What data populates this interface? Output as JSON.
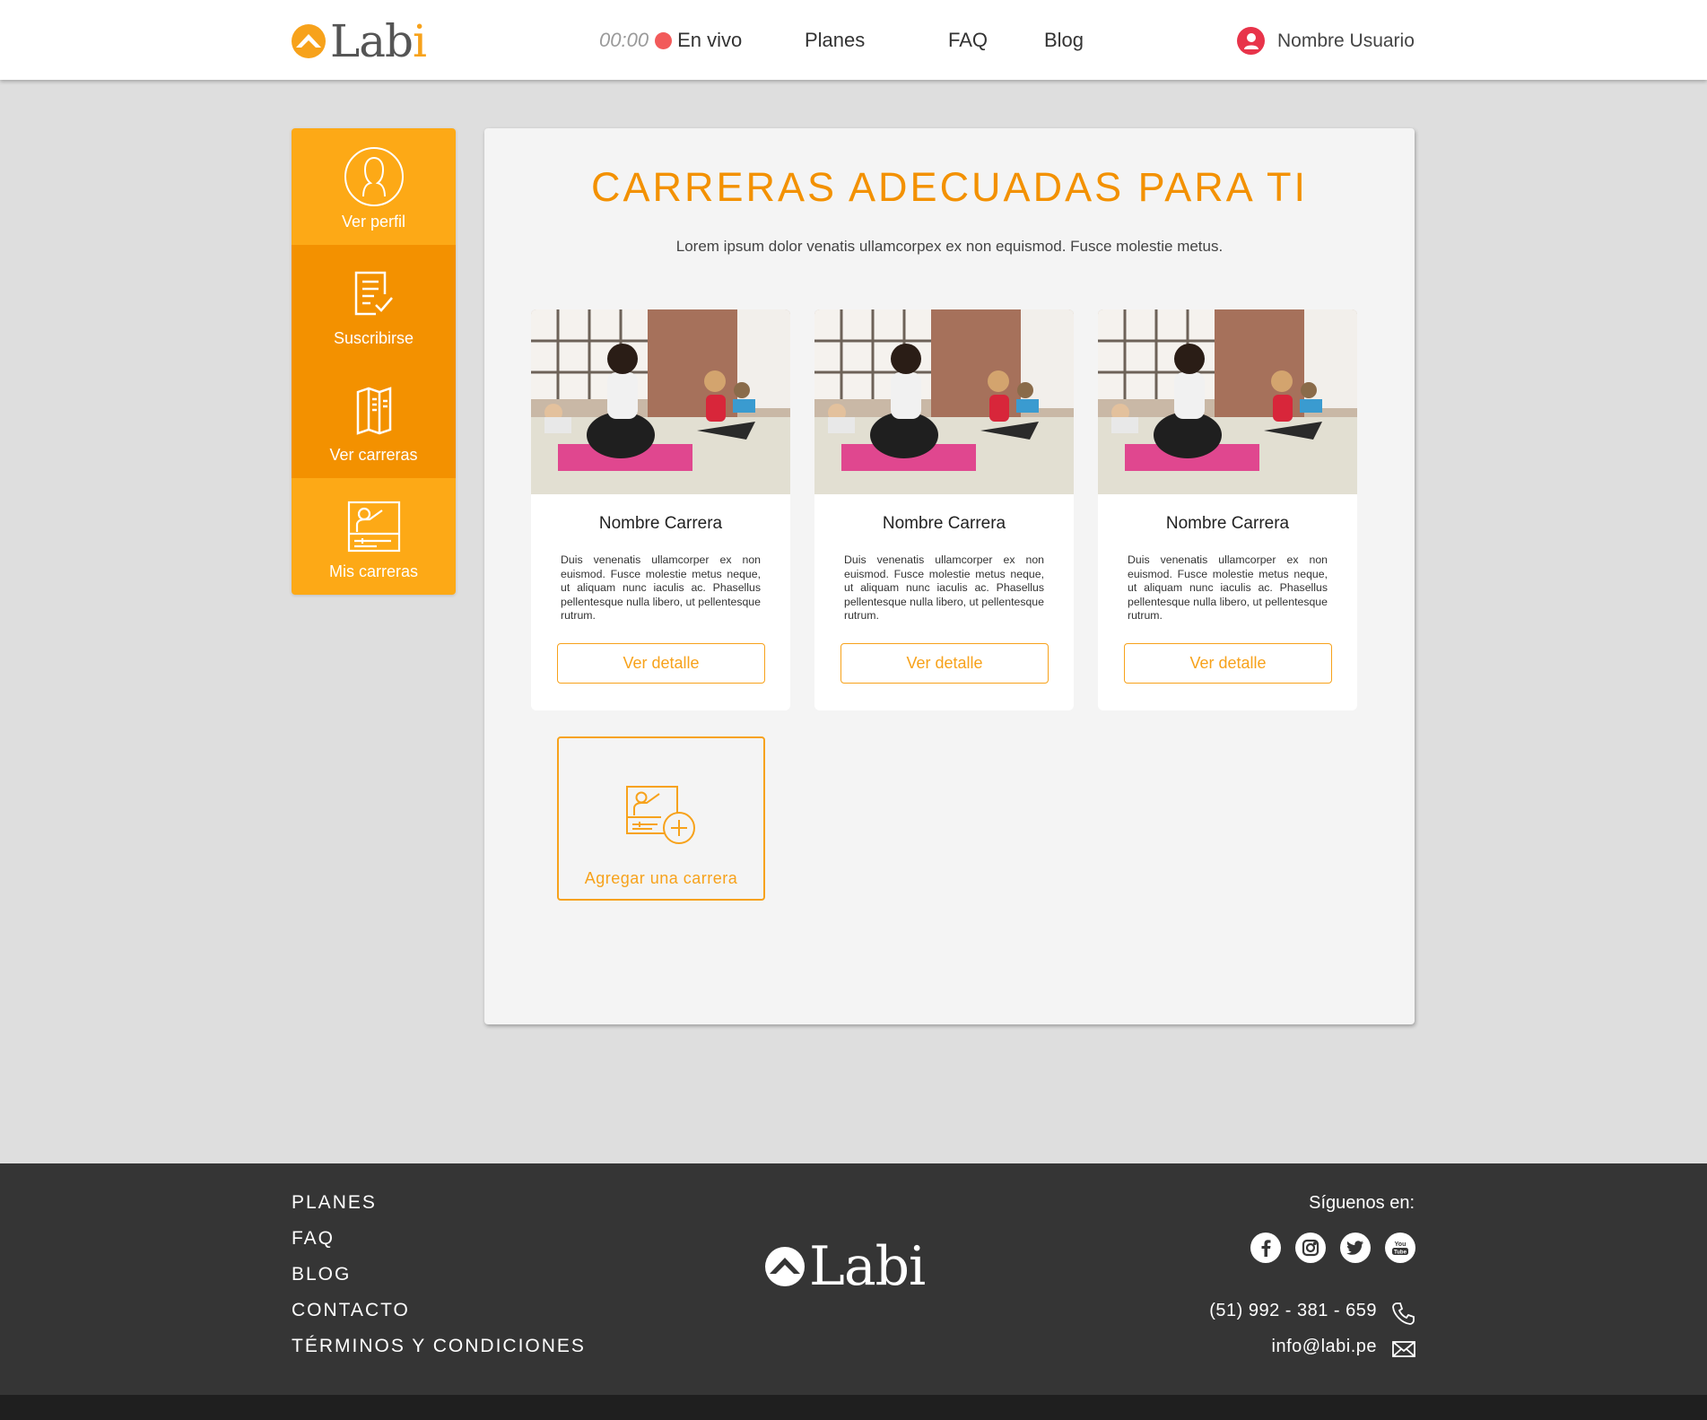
{
  "header": {
    "logo": "Labi",
    "timer": "00:00",
    "live_label": "En vivo",
    "nav": [
      "Planes",
      "FAQ",
      "Blog"
    ],
    "user_name": "Nombre Usuario"
  },
  "sidebar": {
    "items": [
      {
        "label": "Ver perfil",
        "icon": "user-icon"
      },
      {
        "label": "Suscribirse",
        "icon": "document-check-icon"
      },
      {
        "label": "Ver carreras",
        "icon": "brochure-icon"
      },
      {
        "label": "Mis carreras",
        "icon": "presentation-icon"
      }
    ]
  },
  "main": {
    "title": "CARRERAS ADECUADAS PARA TI",
    "subtitle": "Lorem ipsum dolor venatis ullamcorpex ex non equismod. Fusce molestie metus.",
    "cards": [
      {
        "title": "Nombre Carrera",
        "description": "Duis venenatis ullamcorper ex non euismod. Fusce molestie metus neque, ut aliquam nunc iaculis ac. Phasellus pellentesque nulla libero, ut pellentesque rutrum.",
        "button": "Ver detalle"
      },
      {
        "title": "Nombre Carrera",
        "description": "Duis venenatis ullamcorper ex non euismod. Fusce molestie metus neque, ut aliquam nunc iaculis ac. Phasellus pellentesque nulla libero, ut pellentesque rutrum.",
        "button": "Ver detalle"
      },
      {
        "title": "Nombre Carrera",
        "description": "Duis venenatis ullamcorper ex non euismod. Fusce molestie metus neque, ut aliquam nunc iaculis ac. Phasellus pellentesque nulla libero, ut pellentesque rutrum.",
        "button": "Ver detalle"
      }
    ],
    "add_label": "Agregar una carrera"
  },
  "footer": {
    "links": [
      "PLANES",
      "FAQ",
      "BLOG",
      "CONTACTO",
      "TÉRMINOS Y CONDICIONES"
    ],
    "logo": "Labi",
    "follow_label": "Síguenos en:",
    "social": [
      "facebook-icon",
      "instagram-icon",
      "twitter-icon",
      "youtube-icon"
    ],
    "phone": "(51) 992 - 381 - 659",
    "email": "info@labi.pe"
  },
  "colors": {
    "accent": "#f7a21b",
    "sidebar_light": "#fda916",
    "sidebar_dark": "#f39100",
    "live_dot": "#f25a5a",
    "avatar": "#e8344a",
    "footer": "#353535"
  }
}
